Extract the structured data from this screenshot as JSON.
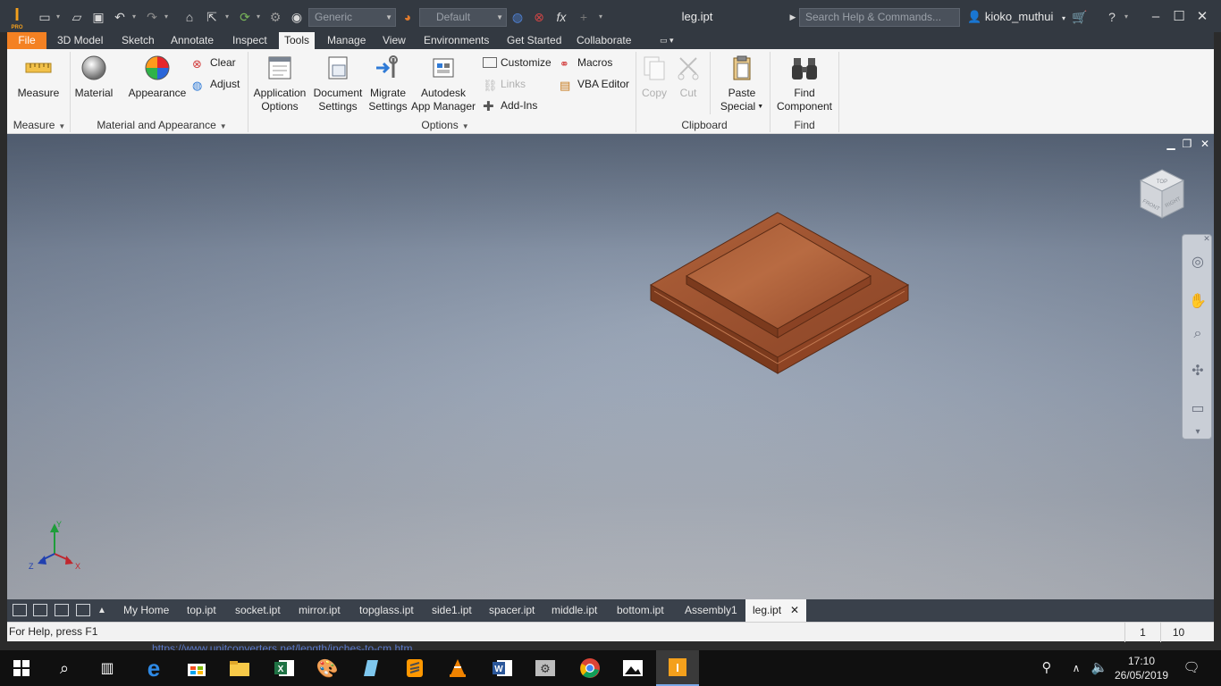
{
  "window": {
    "title": "leg.ipt",
    "logo_sub": "PRO",
    "search_placeholder": "Search Help & Commands...",
    "user": "kioko_muthui",
    "material_combo": "Generic",
    "appearance_combo": "Default"
  },
  "ribbon_tabs": [
    "File",
    "3D Model",
    "Sketch",
    "Annotate",
    "Inspect",
    "Tools",
    "Manage",
    "View",
    "Environments",
    "Get Started",
    "Collaborate"
  ],
  "active_tab": "Tools",
  "ribbon": {
    "measure": {
      "label": "Measure",
      "panel": "Measure"
    },
    "material": {
      "label": "Material"
    },
    "appearance": {
      "label": "Appearance"
    },
    "clear": {
      "label": "Clear"
    },
    "adjust": {
      "label": "Adjust"
    },
    "material_panel": "Material and Appearance",
    "app_options": {
      "line1": "Application",
      "line2": "Options"
    },
    "doc_settings": {
      "line1": "Document",
      "line2": "Settings"
    },
    "migrate": {
      "line1": "Migrate",
      "line2": "Settings"
    },
    "app_manager": {
      "line1": "Autodesk",
      "line2": "App Manager"
    },
    "customize": {
      "label": "Customize"
    },
    "links": {
      "label": "Links"
    },
    "addins": {
      "label": "Add-Ins"
    },
    "macros": {
      "label": "Macros"
    },
    "vba": {
      "label": "VBA Editor"
    },
    "options_panel": "Options",
    "copy": {
      "label": "Copy"
    },
    "cut": {
      "label": "Cut"
    },
    "paste_special": {
      "line1": "Paste",
      "line2": "Special"
    },
    "clipboard_panel": "Clipboard",
    "find_component": {
      "line1": "Find",
      "line2": "Component"
    },
    "find_panel": "Find"
  },
  "viewcube": {
    "top": "TOP",
    "front": "FRONT",
    "right": "RIGHT"
  },
  "axis": {
    "x": "X",
    "y": "Y",
    "z": "Z"
  },
  "document_tabs": [
    "My Home",
    "top.ipt",
    "socket.ipt",
    "mirror.ipt",
    "topglass.ipt",
    "side1.ipt",
    "spacer.ipt",
    "middle.ipt",
    "bottom.ipt",
    "Assembly1",
    "leg.ipt"
  ],
  "active_document": "leg.ipt",
  "status": {
    "help": "For Help, press F1",
    "count1": "1",
    "count2": "10"
  },
  "background_url_fragment": "https://www.unitconverters.net/length/inches-to-cm.htm",
  "taskbar": {
    "time": "17:10",
    "date": "26/05/2019",
    "apps": [
      "start",
      "search",
      "task-view",
      "edge",
      "store",
      "file-explorer",
      "excel",
      "paint",
      "notepad",
      "sublime-text",
      "vlc",
      "word",
      "settings",
      "chrome",
      "photos",
      "inventor"
    ]
  },
  "colors": {
    "file_tab": "#f48122",
    "title_bar": "#333941",
    "wood": "#9a4f2a",
    "axis_x": "#c0262d",
    "axis_y": "#1f9d3a",
    "axis_z": "#2140b0"
  }
}
